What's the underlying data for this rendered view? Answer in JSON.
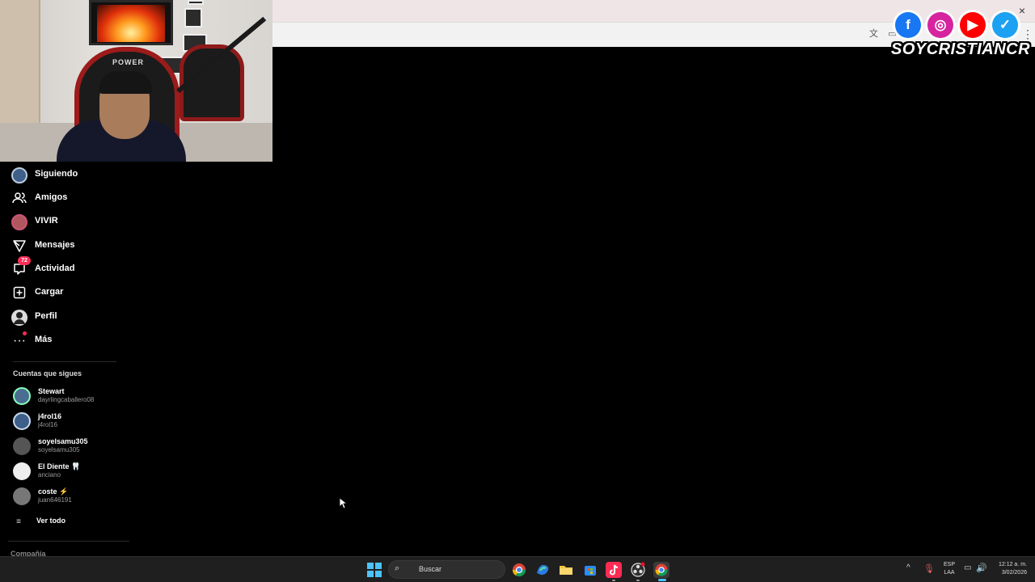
{
  "overlay": {
    "brand_text": "SOYCRISTIANCR",
    "webcam_chair_brand": "POWER",
    "social": [
      {
        "icon": "facebook-icon",
        "glyph": "f",
        "color": "#1877f2"
      },
      {
        "icon": "instagram-icon",
        "glyph": "◎",
        "color": "#d6249f"
      },
      {
        "icon": "youtube-icon",
        "glyph": "▶",
        "color": "#ff0000"
      },
      {
        "icon": "twitter-icon",
        "glyph": "✓",
        "color": "#1da1f2"
      }
    ]
  },
  "nav": {
    "items": [
      {
        "label": "Siguiendo",
        "icon": "following-avatar-icon"
      },
      {
        "label": "Amigos",
        "icon": "friends-icon"
      },
      {
        "label": "VIVIR",
        "icon": "live-avatar-icon"
      },
      {
        "label": "Mensajes",
        "icon": "send-icon"
      },
      {
        "label": "Actividad",
        "icon": "activity-icon",
        "badge": "72"
      },
      {
        "label": "Cargar",
        "icon": "upload-plus-icon"
      },
      {
        "label": "Perfil",
        "icon": "profile-avatar-icon"
      },
      {
        "label": "Más",
        "icon": "more-dots-icon"
      }
    ]
  },
  "following": {
    "header": "Cuentas que sigues",
    "accounts": [
      {
        "name": "Stewart",
        "handle": "dayrlingcaballero08"
      },
      {
        "name": "j4rol16",
        "handle": "j4rol16"
      },
      {
        "name": "soyelsamu305",
        "handle": "soyelsamu305"
      },
      {
        "name": "El Diente 🦷",
        "handle": "anciano"
      },
      {
        "name": "coste ⚡",
        "handle": "juan646191"
      }
    ],
    "see_all": "Ver todo",
    "company": "Compañía"
  },
  "taskbar": {
    "search_placeholder": "Buscar",
    "lang_line1": "ESP",
    "lang_line2": "LAA",
    "time": "12:12 a. m.",
    "date": "3/02/2026",
    "accent": "#4cc2ff"
  }
}
